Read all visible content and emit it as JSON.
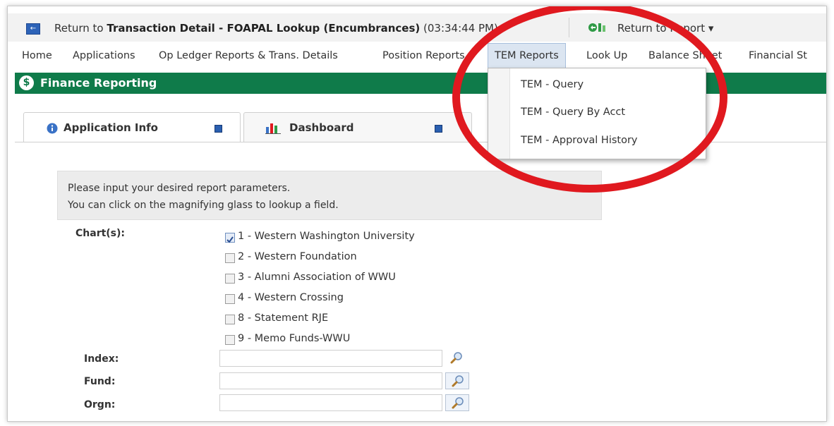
{
  "top_bar": {
    "return_prefix": "Return to ",
    "return_bold": "Transaction Detail - FOAPAL Lookup (Encumbrances)",
    "return_time": " (03:34:44 PM)",
    "return_report_label": "Return to Report ▾"
  },
  "menu": {
    "items": [
      "Home",
      "Applications",
      "Op Ledger Reports & Trans. Details",
      "Position Reports",
      "TEM Reports",
      "Look Up",
      "Balance Sheet",
      "Financial St"
    ],
    "active": "TEM Reports"
  },
  "dropdown": {
    "items": [
      "TEM - Query",
      "TEM - Query By Acct",
      "TEM - Approval History"
    ]
  },
  "banner": {
    "title": "Finance Reporting"
  },
  "tabs": [
    {
      "label": "Application Info"
    },
    {
      "label": "Dashboard"
    }
  ],
  "instructions": {
    "line1": "Please input your desired report parameters.",
    "line2": "You can click on the magnifying glass to lookup a field."
  },
  "form": {
    "charts_label": "Chart(s):",
    "charts": [
      {
        "label": "1 - Western Washington University",
        "checked": true
      },
      {
        "label": "2 - Western Foundation",
        "checked": false
      },
      {
        "label": "3 - Alumni Association of WWU",
        "checked": false
      },
      {
        "label": "4 - Western Crossing",
        "checked": false
      },
      {
        "label": "8 - Statement RJE",
        "checked": false
      },
      {
        "label": "9 - Memo Funds-WWU",
        "checked": false
      }
    ],
    "index_label": "Index:",
    "index_value": "",
    "fund_label": "Fund:",
    "fund_value": "",
    "orgn_label": "Orgn:",
    "orgn_value": ""
  },
  "colors": {
    "brand_green": "#0f7b4a",
    "annotation_red": "#e0191f",
    "active_menu_bg": "#dbe5f1"
  },
  "icons": [
    "back-arrow-icon",
    "report-return-icon",
    "dollar-icon",
    "info-icon",
    "save-icon",
    "bar-chart-icon",
    "magnifier-icon"
  ]
}
